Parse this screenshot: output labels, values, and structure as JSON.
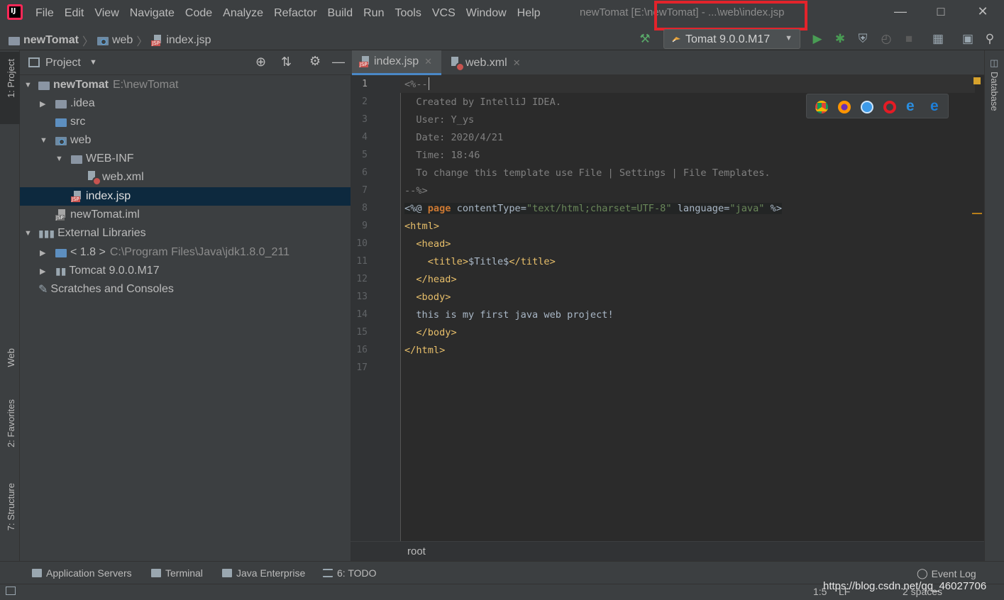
{
  "app": {
    "window_title": "newTomat [E:\\newTomat] - ...\\web\\index.jsp",
    "menu": [
      "File",
      "Edit",
      "View",
      "Navigate",
      "Code",
      "Analyze",
      "Refactor",
      "Build",
      "Run",
      "Tools",
      "VCS",
      "Window",
      "Help"
    ]
  },
  "breadcrumb": {
    "project": "newTomat",
    "folder": "web",
    "file": "index.jsp"
  },
  "run_config": {
    "label": "Tomat 9.0.0.M17",
    "highlight_color": "#e3232b"
  },
  "toolbar_icons": [
    "hammer-icon",
    "run-icon",
    "debug-icon",
    "coverage-icon",
    "profile-icon",
    "stop-icon",
    "project-structure-icon",
    "layout-icon",
    "search-icon"
  ],
  "left_stripe": {
    "project": "1: Project",
    "web": "Web",
    "favorites": "2: Favorites",
    "structure": "7: Structure"
  },
  "project_panel": {
    "title": "Project",
    "tree": [
      {
        "label": "newTomat",
        "path": "E:\\newTomat",
        "bold": true
      },
      {
        "label": ".idea"
      },
      {
        "label": "src"
      },
      {
        "label": "web"
      },
      {
        "label": "WEB-INF"
      },
      {
        "label": "web.xml"
      },
      {
        "label": "index.jsp",
        "selected": true
      },
      {
        "label": "newTomat.iml"
      },
      {
        "label": "External Libraries"
      },
      {
        "label": "< 1.8 >",
        "path": "C:\\Program Files\\Java\\jdk1.8.0_211"
      },
      {
        "label": "Tomcat 9.0.0.M17"
      },
      {
        "label": "Scratches and Consoles"
      }
    ]
  },
  "editor": {
    "tabs": [
      {
        "label": "index.jsp",
        "active": true
      },
      {
        "label": "web.xml"
      }
    ],
    "line_numbers": [
      "1",
      "2",
      "3",
      "4",
      "5",
      "6",
      "7",
      "8",
      "9",
      "10",
      "11",
      "12",
      "13",
      "14",
      "15",
      "16",
      "17"
    ],
    "lines": {
      "l1": "<%--",
      "l2": "  Created by IntelliJ IDEA.",
      "l3": "  User: Y_ys",
      "l4": "  Date: 2020/4/21",
      "l5": "  Time: 18:46",
      "l6": "  To change this template use File | Settings | File Templates.",
      "l7": "--%>",
      "l8_a": "<%@ ",
      "l8_b": "page",
      "l8_c": " contentType=",
      "l8_d": "\"text/html;charset=UTF-8\"",
      "l8_e": " language=",
      "l8_f": "\"java\"",
      "l8_g": " %>",
      "l9": "<html>",
      "l10": "  <head>",
      "l11_a": "    <title>",
      "l11_b": "$Title$",
      "l11_c": "</title>",
      "l12": "  </head>",
      "l13": "  <body>",
      "l14": "  this is my first java web project!",
      "l15": "  </body>",
      "l16": "</html>"
    },
    "breadcrumb_bottom": "root",
    "browser_icons": [
      "chrome-icon",
      "firefox-icon",
      "safari-icon",
      "opera-icon",
      "ie-icon",
      "edge-icon"
    ]
  },
  "right_stripe": {
    "database": "Database"
  },
  "bottom_tools": [
    "Application Servers",
    "Terminal",
    "Java Enterprise",
    "6: TODO"
  ],
  "event_log": "Event Log",
  "status": {
    "position": "1:5",
    "line_sep": "LF",
    "indent": "2 spaces",
    "watermark": "https://blog.csdn.net/qq_46027706"
  }
}
